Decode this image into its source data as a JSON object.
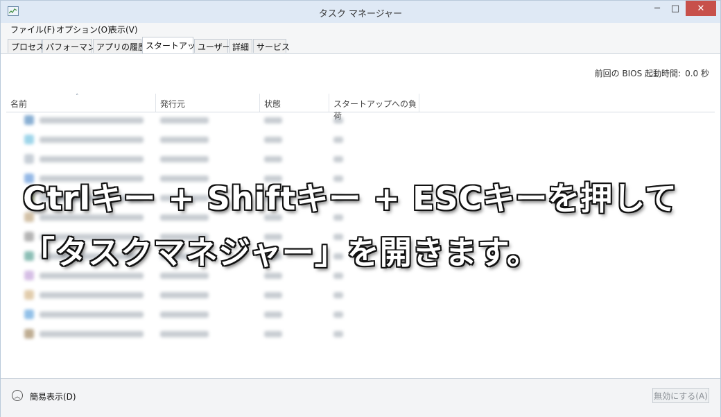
{
  "window": {
    "title": "タスク マネージャー",
    "minimize": "─",
    "maximize": "□",
    "close": "✕"
  },
  "menu": [
    "ファイル(F)",
    "オプション(O)",
    "表示(V)"
  ],
  "tabs": [
    {
      "label": "プロセス"
    },
    {
      "label": "パフォーマンス"
    },
    {
      "label": "アプリの履歴"
    },
    {
      "label": "スタートアップ",
      "active": true
    },
    {
      "label": "ユーザー"
    },
    {
      "label": "詳細"
    },
    {
      "label": "サービス"
    }
  ],
  "bios": {
    "label": "前回の BIOS 起動時間:",
    "value": "0.0 秒"
  },
  "columns": [
    "名前",
    "発行元",
    "状態",
    "スタートアップへの負荷"
  ],
  "sort_indicator": "˄",
  "rows": [
    {
      "icon_color": "#2a6fb0"
    },
    {
      "icon_color": "#4fb3d9"
    },
    {
      "icon_color": "#9aa7b5"
    },
    {
      "icon_color": "#3d7fd1"
    },
    {
      "icon_color": "#6f8a3c"
    },
    {
      "icon_color": "#b09060"
    },
    {
      "icon_color": "#777777"
    },
    {
      "icon_color": "#2f8a7a"
    },
    {
      "icon_color": "#b48ad0"
    },
    {
      "icon_color": "#caa46a"
    },
    {
      "icon_color": "#3a8ed6"
    },
    {
      "icon_color": "#8a6a3a"
    }
  ],
  "caption": {
    "line1": "Ctrlキー + Shiftキー + ESCキーを押して",
    "line2": "「タスクマネジャー」を開きます。"
  },
  "footer": {
    "fewer_details": "簡易表示(D)",
    "disable_button": "無効にする(A)"
  }
}
